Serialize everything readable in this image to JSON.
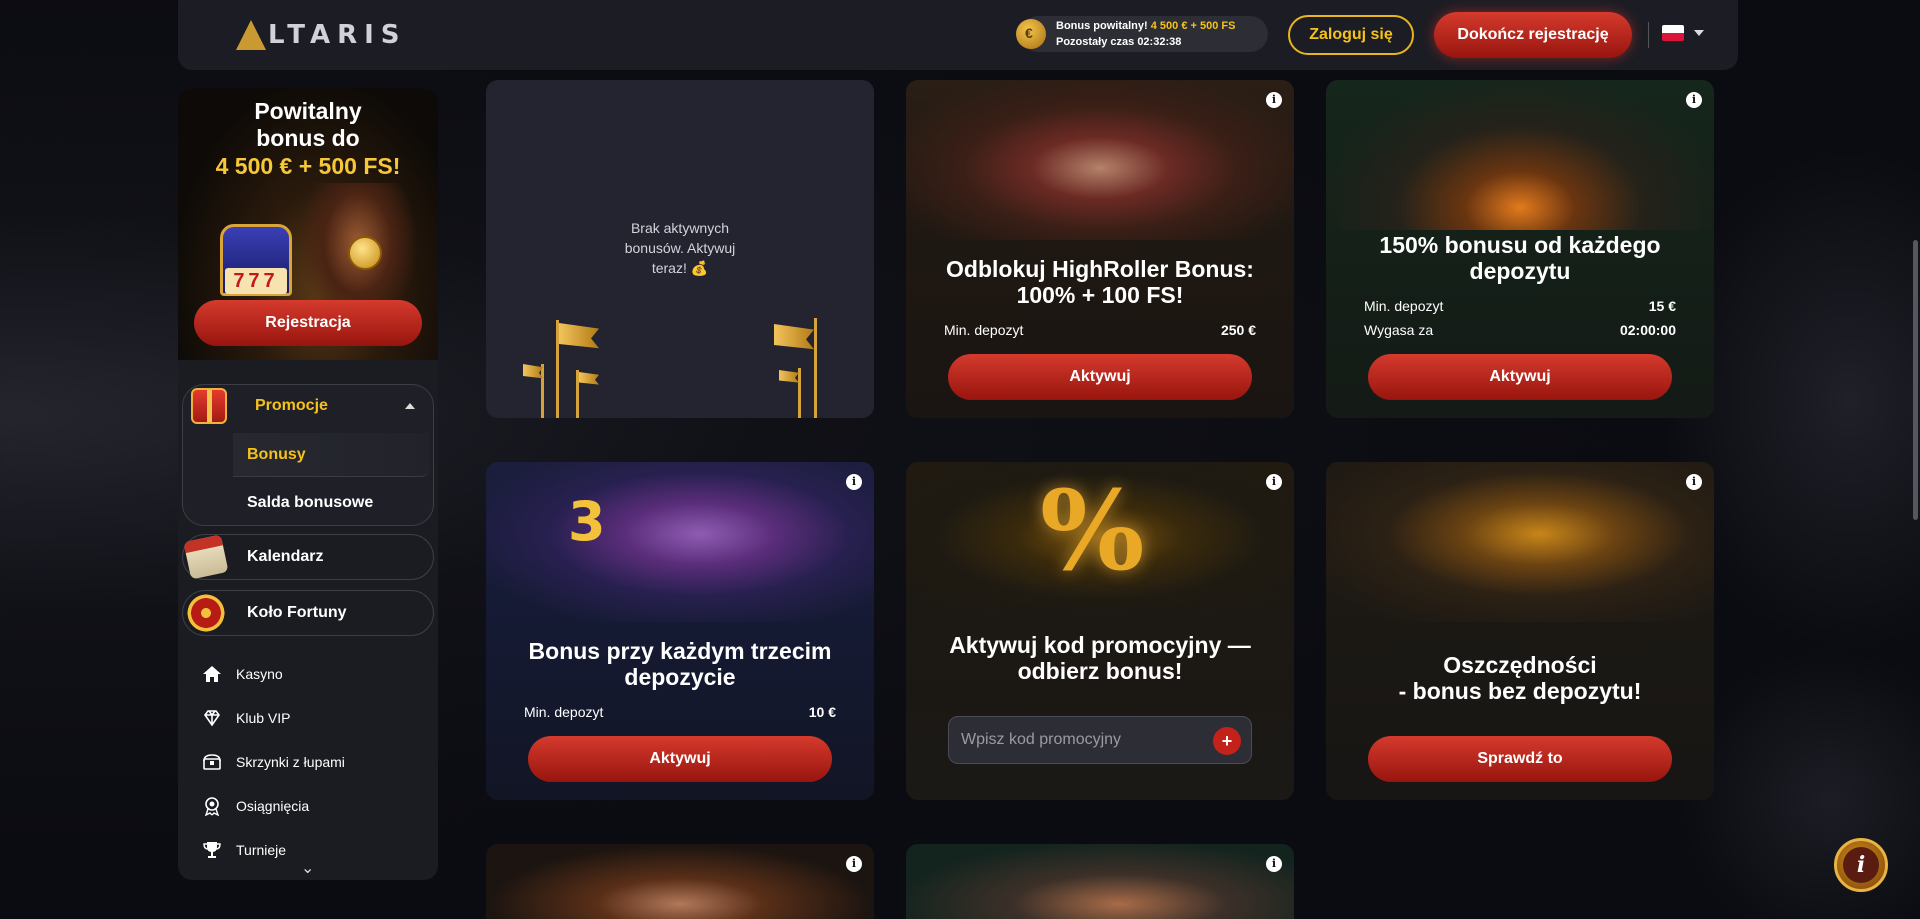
{
  "header": {
    "logo_text": "LTARIS",
    "bonus_line1_prefix": "Bonus powitalny!",
    "bonus_line1_amount": "4 500 € + 500 FS",
    "bonus_line2": "Pozostały czas 02:32:38",
    "login_label": "Zaloguj się",
    "register_label": "Dokończ rejestrację",
    "language_flag": "pl-flag",
    "brand_gold": "#f5c21b",
    "brand_red": "#c3221a"
  },
  "sidebar": {
    "banner": {
      "title_line1": "Powitalny",
      "title_line2": "bonus do",
      "amount": "4 500 € + 500 FS!",
      "slot_digits": "777",
      "register_label": "Rejestracja"
    },
    "promotions": {
      "label": "Promocje",
      "items": [
        {
          "label": "Bonusy",
          "active": true
        },
        {
          "label": "Salda bonusowe",
          "active": false
        }
      ]
    },
    "pills": [
      {
        "label": "Kalendarz",
        "icon": "calendar-icon"
      },
      {
        "label": "Koło Fortuny",
        "icon": "wheel-icon"
      }
    ],
    "nav": [
      {
        "label": "Kasyno",
        "icon": "home-icon"
      },
      {
        "label": "Klub VIP",
        "icon": "diamond-icon"
      },
      {
        "label": "Skrzynki z łupami",
        "icon": "chest-icon"
      },
      {
        "label": "Osiągnięcia",
        "icon": "medal-icon"
      },
      {
        "label": "Turnieje",
        "icon": "trophy-icon"
      }
    ]
  },
  "cards": {
    "empty": {
      "text": "Brak aktywnych bonusów. Aktywuj teraz! 💰"
    },
    "highroller": {
      "title": "Odblokuj HighRoller Bonus: 100% + 100 FS!",
      "min_label": "Min. depozyt",
      "min_value": "250 €",
      "button": "Aktywuj"
    },
    "deposit150": {
      "title": "150% bonusu od każdego depozytu",
      "min_label": "Min. depozyt",
      "min_value": "15 €",
      "expires_label": "Wygasa za",
      "expires_value": "02:00:00",
      "button": "Aktywuj"
    },
    "third": {
      "title": "Bonus przy każdym trzecim depozycie",
      "min_label": "Min. depozyt",
      "min_value": "10 €",
      "button": "Aktywuj",
      "badge": "3"
    },
    "promo_code": {
      "title": "Aktywuj kod promocyjny — odbierz bonus!",
      "placeholder": "Wpisz kod promocyjny",
      "percent_glyph": "%"
    },
    "savings": {
      "title_line1": "Oszczędności",
      "title_line2": "- bonus bez depozytu!",
      "button": "Sprawdź to"
    }
  }
}
